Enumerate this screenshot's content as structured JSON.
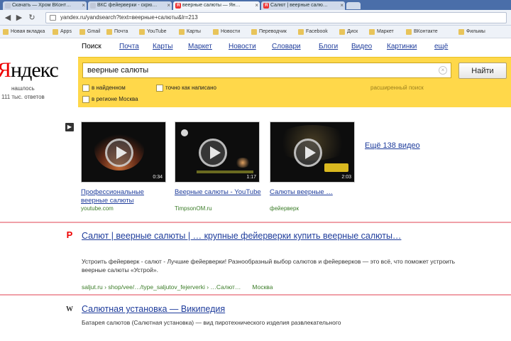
{
  "browser": {
    "tabs": [
      {
        "label": "Скачать — Хром ВКонт…"
      },
      {
        "label": "ВКС фейерверки - скрю…"
      },
      {
        "label": "веерные салюты — Ян…"
      },
      {
        "label": "Салют | веерные салю…"
      }
    ],
    "url": "yandex.ru/yandsearch?text=веерные+салюты&lr=213",
    "bookmarks": [
      "Новая вкладка",
      "Apps",
      "Gmail",
      "Почта",
      "YouTube",
      "Карты",
      "Новости",
      "Переводчик",
      "Facebook",
      "Диск",
      "Маркет",
      "ВКонтакте",
      "Фильмы"
    ]
  },
  "yandex": {
    "logo_first": "Я",
    "logo_rest": "ндекс",
    "logo_sub": "нашлось",
    "logo_sub2": "111 тыс. ответов",
    "services": [
      {
        "label": "Поиск",
        "current": true
      },
      {
        "label": "Почта"
      },
      {
        "label": "Карты"
      },
      {
        "label": "Маркет"
      },
      {
        "label": "Новости"
      },
      {
        "label": "Словари"
      },
      {
        "label": "Блоги"
      },
      {
        "label": "Видео"
      },
      {
        "label": "Картинки"
      },
      {
        "label": "ещё"
      }
    ],
    "search": {
      "query": "веерные салюты",
      "button_label": "Найти",
      "options": [
        "в найденном",
        "точно как написано",
        "в регионе Москва"
      ],
      "advanced_link": "расширенный поиск"
    }
  },
  "video": {
    "items": [
      {
        "title": "Профессиональные веерные салюты",
        "source": "youtube.com",
        "duration": "0:34"
      },
      {
        "title": "Веерные салюты - YouTube",
        "source": "TimpsonOM.ru",
        "duration": "1:17"
      },
      {
        "title": "Салюты веерные …",
        "source": "фейерверк",
        "duration": "2:03"
      }
    ],
    "more_link": "Ещё 138 видео"
  },
  "results": [
    {
      "title": "Салют | веерные салюты | … крупные фейерверки купить веерные салюты…",
      "snippet": "Устроить фейерверк - салют - Лучшие фейерверки! Разнообразный выбор салютов и фейерверков — это всё, что поможет устроить веерные салюты «Устрой».",
      "url": "saljut.ru › shop/vee/…/type_saljutov_fejerverki › …Салют…",
      "region": "Москва"
    },
    {
      "title": "Салютная установка — Википедия",
      "snippet": "Батарея салютов (Салютная установка) — вид пиротехнического изделия развлекательного"
    }
  ],
  "colors": {
    "panel": "#ffd84a",
    "link": "#1f3d9c",
    "url": "#3c7d29",
    "logo_red": "#e00000",
    "highlight": "#f0a0a8"
  }
}
